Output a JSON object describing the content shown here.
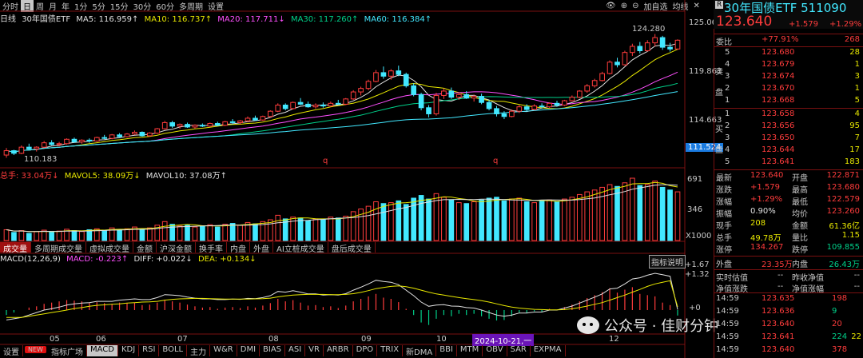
{
  "period_tabs": [
    "分时",
    "日",
    "周",
    "月",
    "年",
    "1分",
    "5分",
    "15分",
    "30分",
    "60分",
    "多周期",
    "设置"
  ],
  "period_active_index": 1,
  "top_actions": {
    "add_watch": "加自选",
    "avg_line": "均线"
  },
  "ma_legend": {
    "prefix": "日线",
    "title": "30年国债ETF",
    "ma5": "MA5: 116.959↑",
    "ma10": "MA10: 116.737↑",
    "ma20": "MA20: 117.711↓",
    "ma30": "MA30: 117.260↑",
    "ma60": "MA60: 116.384↑"
  },
  "price_axis": [
    "125.063",
    "119.863",
    "114.663"
  ],
  "price_current_tag": "111.524",
  "price_high_label": "124.280",
  "price_low_label": "110.183",
  "vol_legend": {
    "total": "总手: 33.04万↓",
    "mavol5": "MAVOL5: 38.09万↓",
    "mavol10": "MAVOL10: 37.08万↑"
  },
  "vol_axis": [
    "691",
    "346",
    "X1000"
  ],
  "indicator_tabs": [
    "成交量",
    "多周期成交量",
    "虚拟成交量",
    "金额",
    "沪深金额",
    "换手率",
    "内盘",
    "外盘",
    "AI立桩成交量",
    "盘后成交量"
  ],
  "macd_legend": {
    "name": "MACD(12,26,9)",
    "macd": "MACD: -0.223↑",
    "diff": "DIFF: +0.022↓",
    "dea": "DEA: +0.134↓"
  },
  "macd_help": "指标说明",
  "macd_axis": [
    "+1.67",
    "+1.32",
    "+0"
  ],
  "x_axis": [
    "05",
    "06",
    "07",
    "08",
    "09",
    "10",
    "12"
  ],
  "x_cursor_label": "2024-10-21,一",
  "q_marks": [
    "q",
    "q"
  ],
  "bottom_tabs": [
    "设置",
    "NEW",
    "指标广场",
    "MACD",
    "KDJ",
    "RSI",
    "BOLL",
    "主力",
    "W&R",
    "DMI",
    "BIAS",
    "ASI",
    "VR",
    "ARBR",
    "DPO",
    "TRIX",
    "新DMA",
    "BBI",
    "MTM",
    "OBV",
    "SAR",
    "EXPMA"
  ],
  "watermark": "公众号 · 佳财分钟",
  "quote": {
    "title": "30年国债ETF 511090",
    "price": "123.640",
    "change": "+1.579",
    "change_pct": "+1.29%",
    "webi_label": "委比",
    "webi_value": "+77.91%",
    "webi_diff": "268",
    "sell_side": "卖盘",
    "buy_side": "买盘",
    "asks": [
      {
        "lvl": "5",
        "price": "123.680",
        "vol": "28"
      },
      {
        "lvl": "4",
        "price": "123.679",
        "vol": "1"
      },
      {
        "lvl": "3",
        "price": "123.674",
        "vol": "3"
      },
      {
        "lvl": "2",
        "price": "123.670",
        "vol": "1"
      },
      {
        "lvl": "1",
        "price": "123.668",
        "vol": "5"
      }
    ],
    "bids": [
      {
        "lvl": "1",
        "price": "123.658",
        "vol": "4"
      },
      {
        "lvl": "2",
        "price": "123.656",
        "vol": "95"
      },
      {
        "lvl": "3",
        "price": "123.650",
        "vol": "7"
      },
      {
        "lvl": "4",
        "price": "123.644",
        "vol": "17"
      },
      {
        "lvl": "5",
        "price": "123.641",
        "vol": "183"
      }
    ],
    "stats": [
      {
        "l1": "最新",
        "v1": "123.640",
        "c1": "r",
        "l2": "开盘",
        "v2": "122.871",
        "c2": "r"
      },
      {
        "l1": "涨跌",
        "v1": "+1.579",
        "c1": "r",
        "l2": "最高",
        "v2": "123.680",
        "c2": "r"
      },
      {
        "l1": "涨幅",
        "v1": "+1.29%",
        "c1": "r",
        "l2": "最低",
        "v2": "122.579",
        "c2": "r"
      },
      {
        "l1": "振幅",
        "v1": "0.90%",
        "c1": "w",
        "l2": "均价",
        "v2": "123.260",
        "c2": "r"
      },
      {
        "l1": "现手",
        "v1": "208",
        "c1": "y",
        "l2": "金额",
        "v2": "61.36亿",
        "c2": "y"
      },
      {
        "l1": "总手",
        "v1": "49.78万",
        "c1": "y",
        "l2": "量比",
        "v2": "1.15",
        "c2": "y"
      },
      {
        "l1": "涨停",
        "v1": "134.267",
        "c1": "r",
        "l2": "跌停",
        "v2": "109.855",
        "c2": "g"
      }
    ],
    "outer": {
      "label": "外盘",
      "value": "23.35万",
      "label2": "内盘",
      "value2": "26.43万"
    },
    "net": [
      {
        "l1": "实时估值",
        "v1": "--",
        "l2": "昨收净值",
        "v2": "--"
      },
      {
        "l1": "净值涨跌",
        "v1": "--",
        "l2": "净值涨幅",
        "v2": "--"
      }
    ],
    "ticks": [
      {
        "time": "14:59",
        "price": "123.635",
        "vol": "198"
      },
      {
        "time": "14:59",
        "price": "123.636",
        "vol": "9"
      },
      {
        "time": "14:59",
        "price": "123.640",
        "vol": "20"
      },
      {
        "time": "14:59",
        "price": "123.641",
        "vol": "224"
      },
      {
        "time": "14:59",
        "price": "123.640",
        "vol": "378"
      }
    ],
    "tick_extra": [
      "",
      "",
      "",
      "22",
      ""
    ]
  },
  "chart_data": {
    "type": "candlestick",
    "price_ylim": [
      109.5,
      126.0
    ],
    "candles": [
      [
        110.5,
        111.3,
        110.2,
        111.0
      ],
      [
        111.0,
        111.1,
        110.5,
        110.7
      ],
      [
        110.7,
        111.6,
        110.6,
        111.4
      ],
      [
        111.4,
        111.8,
        111.1,
        111.2
      ],
      [
        111.2,
        111.5,
        110.9,
        111.4
      ],
      [
        111.4,
        112.1,
        111.3,
        111.9
      ],
      [
        111.9,
        112.2,
        111.6,
        111.7
      ],
      [
        111.7,
        112.0,
        111.5,
        111.8
      ],
      [
        111.8,
        112.4,
        111.7,
        112.3
      ],
      [
        112.3,
        112.5,
        111.9,
        112.0
      ],
      [
        112.0,
        112.3,
        111.8,
        112.2
      ],
      [
        112.2,
        112.4,
        111.9,
        112.1
      ],
      [
        112.1,
        112.6,
        112.0,
        112.5
      ],
      [
        112.5,
        112.8,
        112.3,
        112.4
      ],
      [
        112.4,
        112.9,
        112.3,
        112.8
      ],
      [
        112.8,
        113.0,
        112.5,
        112.6
      ],
      [
        112.6,
        113.0,
        112.5,
        112.9
      ],
      [
        112.9,
        113.3,
        112.8,
        113.1
      ],
      [
        113.1,
        113.2,
        112.6,
        112.7
      ],
      [
        112.7,
        113.1,
        112.6,
        113.0
      ],
      [
        113.0,
        113.6,
        112.9,
        113.5
      ],
      [
        113.5,
        114.4,
        113.4,
        114.2
      ],
      [
        114.2,
        114.4,
        113.6,
        113.8
      ],
      [
        113.8,
        114.1,
        113.5,
        114.0
      ],
      [
        114.0,
        114.2,
        113.6,
        113.7
      ],
      [
        113.7,
        114.0,
        113.5,
        113.9
      ],
      [
        113.9,
        114.1,
        113.7,
        113.8
      ],
      [
        113.8,
        114.2,
        113.7,
        114.1
      ],
      [
        114.1,
        114.3,
        113.8,
        113.9
      ],
      [
        113.9,
        114.4,
        113.8,
        114.3
      ],
      [
        114.3,
        114.6,
        114.0,
        114.2
      ],
      [
        114.2,
        114.5,
        114.0,
        114.4
      ],
      [
        114.4,
        114.9,
        114.3,
        114.7
      ],
      [
        114.7,
        115.0,
        114.4,
        114.5
      ],
      [
        114.5,
        115.0,
        114.4,
        114.9
      ],
      [
        114.9,
        115.6,
        114.8,
        115.5
      ],
      [
        115.5,
        116.4,
        115.4,
        116.2
      ],
      [
        116.2,
        116.4,
        115.6,
        115.8
      ],
      [
        115.8,
        116.6,
        115.7,
        116.5
      ],
      [
        116.5,
        117.0,
        116.2,
        116.3
      ],
      [
        116.3,
        116.6,
        115.9,
        116.0
      ],
      [
        116.0,
        116.4,
        115.8,
        116.2
      ],
      [
        116.2,
        116.5,
        115.9,
        116.1
      ],
      [
        116.1,
        116.6,
        116.0,
        116.4
      ],
      [
        116.4,
        116.8,
        116.2,
        116.3
      ],
      [
        116.3,
        117.0,
        116.2,
        116.9
      ],
      [
        116.9,
        117.9,
        116.8,
        117.7
      ],
      [
        117.7,
        118.3,
        117.3,
        118.1
      ],
      [
        118.1,
        119.1,
        117.9,
        118.9
      ],
      [
        118.9,
        120.2,
        118.8,
        119.9
      ],
      [
        119.9,
        120.6,
        119.2,
        119.5
      ],
      [
        119.5,
        120.3,
        119.1,
        120.1
      ],
      [
        120.1,
        120.7,
        119.5,
        119.7
      ],
      [
        119.7,
        119.9,
        118.2,
        118.4
      ],
      [
        118.4,
        118.7,
        117.2,
        117.4
      ],
      [
        117.4,
        117.6,
        115.6,
        115.9
      ],
      [
        115.9,
        116.2,
        114.8,
        115.2
      ],
      [
        115.2,
        117.6,
        115.0,
        117.3
      ],
      [
        117.3,
        118.1,
        116.9,
        117.8
      ],
      [
        117.8,
        118.2,
        116.9,
        117.1
      ],
      [
        117.1,
        117.6,
        116.8,
        117.4
      ],
      [
        117.4,
        117.8,
        116.9,
        117.0
      ],
      [
        117.0,
        117.4,
        116.6,
        117.2
      ],
      [
        117.2,
        117.5,
        116.3,
        116.5
      ],
      [
        116.5,
        116.8,
        115.6,
        115.8
      ],
      [
        115.8,
        116.1,
        114.9,
        115.2
      ],
      [
        115.2,
        115.5,
        114.6,
        114.9
      ],
      [
        114.9,
        115.7,
        114.8,
        115.5
      ],
      [
        115.5,
        116.2,
        115.3,
        116.0
      ],
      [
        116.0,
        116.3,
        115.5,
        115.7
      ],
      [
        115.7,
        116.3,
        115.6,
        116.1
      ],
      [
        116.1,
        116.4,
        115.8,
        116.0
      ],
      [
        116.0,
        116.5,
        115.9,
        116.4
      ],
      [
        116.4,
        116.7,
        116.0,
        116.2
      ],
      [
        116.2,
        116.8,
        116.1,
        116.7
      ],
      [
        116.7,
        117.3,
        116.6,
        117.1
      ],
      [
        117.1,
        117.9,
        117.0,
        117.8
      ],
      [
        117.8,
        118.6,
        117.6,
        118.4
      ],
      [
        118.4,
        119.2,
        118.2,
        119.0
      ],
      [
        119.0,
        120.0,
        118.9,
        119.8
      ],
      [
        119.8,
        121.3,
        119.7,
        121.1
      ],
      [
        121.1,
        121.6,
        120.5,
        120.8
      ],
      [
        120.8,
        122.4,
        120.7,
        122.2
      ],
      [
        122.2,
        123.2,
        121.8,
        122.9
      ],
      [
        122.9,
        123.4,
        122.1,
        122.4
      ],
      [
        122.4,
        123.6,
        122.3,
        123.3
      ],
      [
        123.3,
        124.3,
        122.9,
        123.9
      ],
      [
        123.9,
        124.1,
        122.5,
        122.8
      ],
      [
        122.8,
        123.3,
        122.3,
        122.6
      ],
      [
        122.6,
        123.7,
        122.5,
        123.6
      ]
    ],
    "volume_ylim": [
      0,
      700
    ],
    "volume": [
      120,
      90,
      110,
      80,
      100,
      115,
      95,
      105,
      125,
      110,
      100,
      120,
      130,
      115,
      140,
      120,
      130,
      150,
      125,
      140,
      170,
      210,
      180,
      160,
      170,
      150,
      160,
      175,
      150,
      180,
      190,
      170,
      200,
      185,
      210,
      230,
      280,
      240,
      260,
      250,
      220,
      240,
      230,
      260,
      250,
      270,
      320,
      350,
      380,
      430,
      410,
      420,
      440,
      400,
      470,
      500,
      460,
      520,
      480,
      450,
      420,
      410,
      430,
      450,
      470,
      480,
      440,
      460,
      470,
      430,
      420,
      440,
      450,
      430,
      460,
      480,
      510,
      540,
      560,
      590,
      620,
      600,
      640,
      691,
      610,
      620,
      660,
      590,
      560,
      540
    ],
    "macd_ylim": [
      -0.9,
      1.8
    ],
    "macd": [
      -0.2,
      -0.1,
      0.0,
      0.1,
      0.15,
      0.25,
      0.3,
      0.35,
      0.4,
      0.38,
      0.35,
      0.3,
      0.32,
      0.28,
      0.25,
      0.3,
      0.28,
      0.3,
      0.2,
      0.22,
      0.3,
      0.42,
      0.35,
      0.3,
      0.22,
      0.15,
      0.1,
      0.12,
      0.05,
      0.1,
      0.12,
      0.08,
      0.15,
      0.1,
      0.18,
      0.28,
      0.45,
      0.35,
      0.4,
      0.3,
      0.18,
      0.2,
      0.12,
      0.15,
      0.08,
      0.18,
      0.35,
      0.45,
      0.55,
      0.65,
      0.5,
      0.45,
      0.32,
      0.05,
      -0.2,
      -0.5,
      -0.6,
      -0.35,
      -0.2,
      -0.25,
      -0.15,
      -0.2,
      -0.15,
      -0.25,
      -0.35,
      -0.42,
      -0.4,
      -0.25,
      -0.1,
      -0.12,
      -0.05,
      -0.08,
      0.05,
      0.0,
      0.12,
      0.22,
      0.35,
      0.48,
      0.6,
      0.72,
      0.88,
      0.7,
      0.82,
      0.92,
      0.65,
      0.6,
      0.55,
      0.3,
      0.2,
      -0.22
    ],
    "diff": [
      -0.4,
      -0.35,
      -0.3,
      -0.2,
      -0.1,
      0.0,
      0.05,
      0.12,
      0.2,
      0.25,
      0.28,
      0.3,
      0.35,
      0.35,
      0.35,
      0.4,
      0.42,
      0.45,
      0.42,
      0.42,
      0.5,
      0.62,
      0.6,
      0.58,
      0.52,
      0.48,
      0.45,
      0.45,
      0.42,
      0.42,
      0.44,
      0.43,
      0.47,
      0.46,
      0.5,
      0.58,
      0.75,
      0.72,
      0.78,
      0.72,
      0.65,
      0.65,
      0.6,
      0.62,
      0.6,
      0.66,
      0.8,
      0.92,
      1.05,
      1.2,
      1.15,
      1.12,
      1.02,
      0.8,
      0.58,
      0.32,
      0.15,
      0.2,
      0.22,
      0.16,
      0.15,
      0.1,
      0.08,
      0.0,
      -0.1,
      -0.2,
      -0.25,
      -0.2,
      -0.12,
      -0.12,
      -0.08,
      -0.08,
      0.0,
      0.0,
      0.08,
      0.16,
      0.28,
      0.4,
      0.52,
      0.65,
      0.85,
      0.88,
      1.05,
      1.25,
      1.3,
      1.4,
      1.48,
      1.42,
      1.36,
      0.02
    ],
    "dea": [
      -0.3,
      -0.3,
      -0.3,
      -0.25,
      -0.2,
      -0.15,
      -0.1,
      -0.05,
      0.0,
      0.06,
      0.1,
      0.15,
      0.19,
      0.21,
      0.23,
      0.25,
      0.28,
      0.3,
      0.32,
      0.33,
      0.35,
      0.4,
      0.43,
      0.45,
      0.46,
      0.47,
      0.47,
      0.46,
      0.45,
      0.44,
      0.44,
      0.44,
      0.44,
      0.45,
      0.46,
      0.48,
      0.53,
      0.57,
      0.6,
      0.62,
      0.63,
      0.63,
      0.63,
      0.62,
      0.62,
      0.63,
      0.66,
      0.71,
      0.78,
      0.86,
      0.91,
      0.95,
      0.97,
      0.94,
      0.88,
      0.8,
      0.72,
      0.65,
      0.6,
      0.55,
      0.5,
      0.46,
      0.42,
      0.38,
      0.32,
      0.25,
      0.18,
      0.12,
      0.08,
      0.05,
      0.03,
      0.02,
      0.01,
      0.01,
      0.02,
      0.05,
      0.1,
      0.16,
      0.23,
      0.3,
      0.4,
      0.5,
      0.6,
      0.72,
      0.83,
      0.95,
      1.05,
      1.12,
      1.18,
      0.13
    ]
  }
}
